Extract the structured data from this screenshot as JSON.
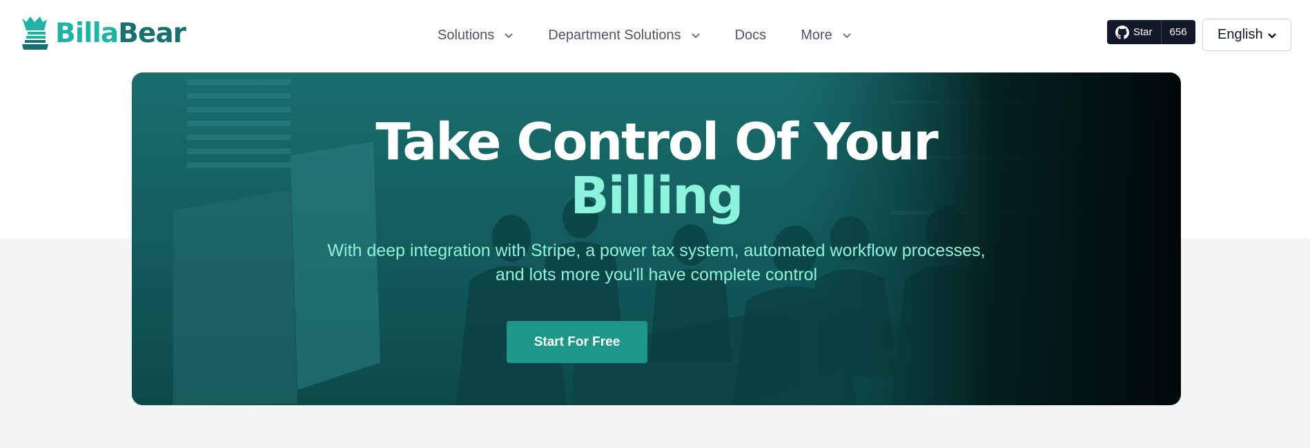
{
  "brand": {
    "name_part1": "Billa",
    "name_part2": "Bear",
    "colors": {
      "primary": "#1fb3a6",
      "dark": "#19706e",
      "accent": "#8ef3dd"
    }
  },
  "nav": {
    "items": [
      {
        "label": "Solutions",
        "has_dropdown": true
      },
      {
        "label": "Department Solutions",
        "has_dropdown": true
      },
      {
        "label": "Docs",
        "has_dropdown": false
      },
      {
        "label": "More",
        "has_dropdown": true
      }
    ]
  },
  "github": {
    "star_label": "Star",
    "count": "656",
    "icon": "github-icon"
  },
  "language": {
    "selected": "English"
  },
  "hero": {
    "title_line1": "Take Control Of Your",
    "title_line2": "Billing",
    "subtitle_line1": "With deep integration with Stripe, a power tax system, automated workflow processes,",
    "subtitle_line2": "and lots more you'll have complete control",
    "cta_label": "Start For Free"
  }
}
